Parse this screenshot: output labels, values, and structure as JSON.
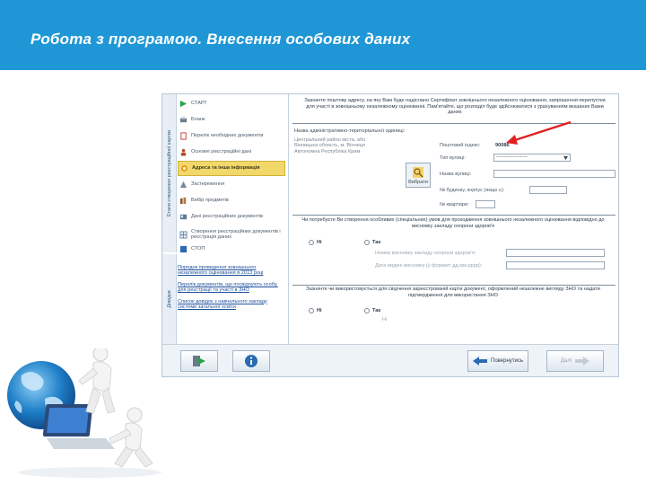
{
  "header": {
    "title": "Робота з програмою. Внесення особових даних"
  },
  "app": {
    "sidebar": {
      "tab_top": "Етапи створення реєстраційної картки",
      "tab_bottom": "Довідки",
      "items": [
        {
          "label": "СТАРТ",
          "icon": "play-icon",
          "color": "#2aa34a"
        },
        {
          "label": "Бланк",
          "icon": "printer-icon",
          "color": "#6f7e8e"
        },
        {
          "label": "Перелік необхідних документів",
          "icon": "document-icon",
          "color": "#c0392b"
        },
        {
          "label": "Основні реєстраційні дані",
          "icon": "person-icon",
          "color": "#b34a2a"
        },
        {
          "label": "Адреса та інша інформація",
          "icon": "address-icon",
          "color": "#e0a020"
        },
        {
          "label": "Застереження",
          "icon": "warning-icon",
          "color": "#7a8898"
        },
        {
          "label": "Вибір предметів",
          "icon": "books-icon",
          "color": "#8b5a2b"
        },
        {
          "label": "Дані реєстраційних документів",
          "icon": "id-card-icon",
          "color": "#5a7a9a"
        },
        {
          "label": "Створення реєстраційних документів і реєстрація даних",
          "icon": "grid-icon",
          "color": "#6a8aaa"
        },
        {
          "label": "СТОП",
          "icon": "stop-icon",
          "color": "#2a6ab0"
        }
      ],
      "links": [
        "Порядок проведення зовнішнього незалежного оцінювання в 2013 році",
        "Перелік документів, що посвідчують особу, для реєстрації та участі в ЗНО",
        "Список довідок з навчального закладу системи загальної освіти"
      ]
    },
    "main": {
      "notice": "Зазначте поштову адресу, на яку Вам буде надіслано Сертифікат зовнішнього незалежного оцінювання, запрошення-перепустки для участі в зовнішньому незалежному оцінюванні. Пам'ятайте, що розподіл буде здійснюватися з урахуванням вказаних Вами даних",
      "admin_label": "Назва адміністративно-територіальної одиниці:",
      "admin_box": "Центральний район міста, або Вінницька область, м. Вінниця Автономна Республіка Крим",
      "choose_label": "Вибрати",
      "fields": [
        {
          "label": "Поштовий індекс:",
          "value": "90086"
        },
        {
          "label": "Тип вулиці:",
          "value": "---------------------"
        },
        {
          "label": "Назва вулиці:",
          "value": ""
        },
        {
          "label": "№ будинку, корпус (якщо є):",
          "value": ""
        },
        {
          "label": "№ квартири:",
          "value": ""
        }
      ],
      "question1": "Чи потребуєте Ви створення особливих (спеціальних) умов для проходження зовнішнього незалежного оцінювання відповідно до висновку закладу охорони здоров'я",
      "q1_no": "Ні",
      "q1_yes": "Так",
      "q1_fields": [
        "Номер висновку закладу охорони здоров'я:",
        "Дата видачі висновку (у форматі дд.мм.рррр):"
      ],
      "question2": "Зазначте чи використовується для свідчення зареєстрованій карти документ, оформлений незалежне вигляду ЗНО та надати підтвердження для використання ЗНО",
      "q2_no": "Ні",
      "q2_yes": "Так",
      "q2_sub": "Ні"
    },
    "bottom": {
      "back_label": "Повернутись",
      "next_label": "Далі"
    }
  },
  "colors": {
    "header_bg": "#1f97d6",
    "arrow": "#e02020",
    "active_item": "#f2d86a"
  }
}
